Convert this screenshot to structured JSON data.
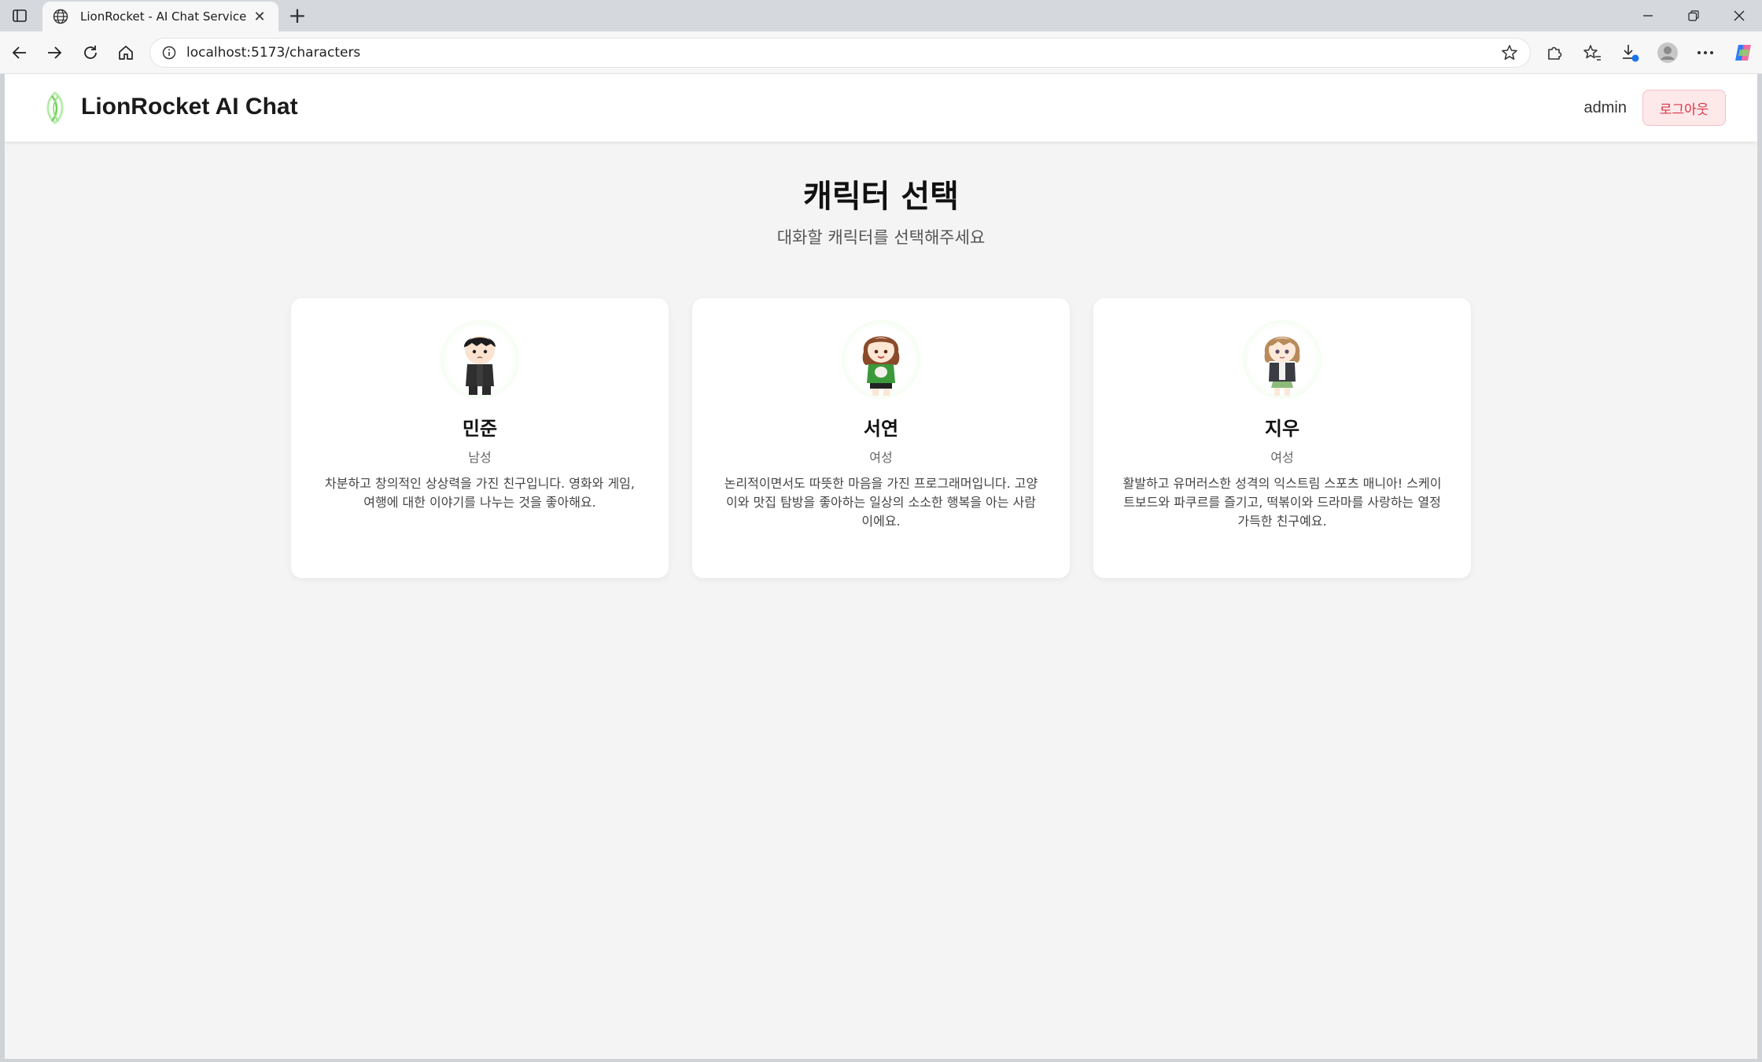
{
  "browser": {
    "tab_title": "LionRocket - AI Chat Service",
    "url": "localhost:5173/characters",
    "icons": {
      "tab_actions": "tab-actions-icon",
      "tab": "globe-icon",
      "close": "close-icon",
      "new_tab": "plus-icon",
      "back": "back-arrow-icon",
      "forward": "forward-arrow-icon",
      "reload": "reload-icon",
      "home": "home-icon",
      "site_info": "info-icon",
      "favorite": "star-icon",
      "extensions": "puzzle-icon",
      "favorites": "favorites-icon",
      "downloads": "download-icon",
      "profile": "profile-icon",
      "more": "more-icon",
      "copilot": "copilot-icon"
    }
  },
  "app": {
    "brand": "LionRocket AI Chat",
    "user": "admin",
    "logout_label": "로그아웃",
    "colors": {
      "logout_text": "#dc3545",
      "logout_bg": "#fde8ea",
      "logo_green": "#6fd15a"
    }
  },
  "page": {
    "title": "캐릭터 선택",
    "subtitle": "대화할 캐릭터를 선택해주세요"
  },
  "characters": [
    {
      "name": "민준",
      "gender": "남성",
      "description": "차분하고 창의적인 상상력을 가진 친구입니다. 영화와 게임, 여행에 대한 이야기를 나누는 것을 좋아해요."
    },
    {
      "name": "서연",
      "gender": "여성",
      "description": "논리적이면서도 따뜻한 마음을 가진 프로그래머입니다. 고양이와 맛집 탐방을 좋아하는 일상의 소소한 행복을 아는 사람이에요."
    },
    {
      "name": "지우",
      "gender": "여성",
      "description": "활발하고 유머러스한 성격의 익스트림 스포츠 매니아! 스케이트보드와 파쿠르를 즐기고, 떡볶이와 드라마를 사랑하는 열정 가득한 친구예요."
    }
  ]
}
